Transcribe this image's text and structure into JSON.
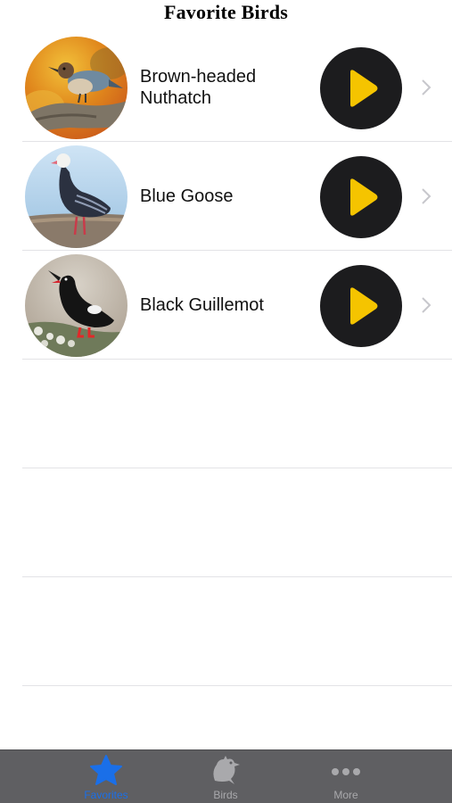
{
  "header": {
    "title": "Favorite Birds"
  },
  "birds": [
    {
      "name": "Brown-headed Nuthatch",
      "image_icon": "nuthatch-photo"
    },
    {
      "name": "Blue Goose",
      "image_icon": "goose-photo"
    },
    {
      "name": "Black Guillemot",
      "image_icon": "guillemot-photo"
    }
  ],
  "play_button": {
    "icon": "play-icon",
    "bg_color": "#1c1c1e",
    "icon_color": "#f5c400"
  },
  "tabbar": {
    "bg_color": "#5f5f62",
    "active_color": "#1a6fe8",
    "tabs": [
      {
        "label": "Favorites",
        "icon": "star-icon",
        "active": true
      },
      {
        "label": "Birds",
        "icon": "bird-icon",
        "active": false
      },
      {
        "label": "More",
        "icon": "more-icon",
        "active": false
      }
    ]
  }
}
